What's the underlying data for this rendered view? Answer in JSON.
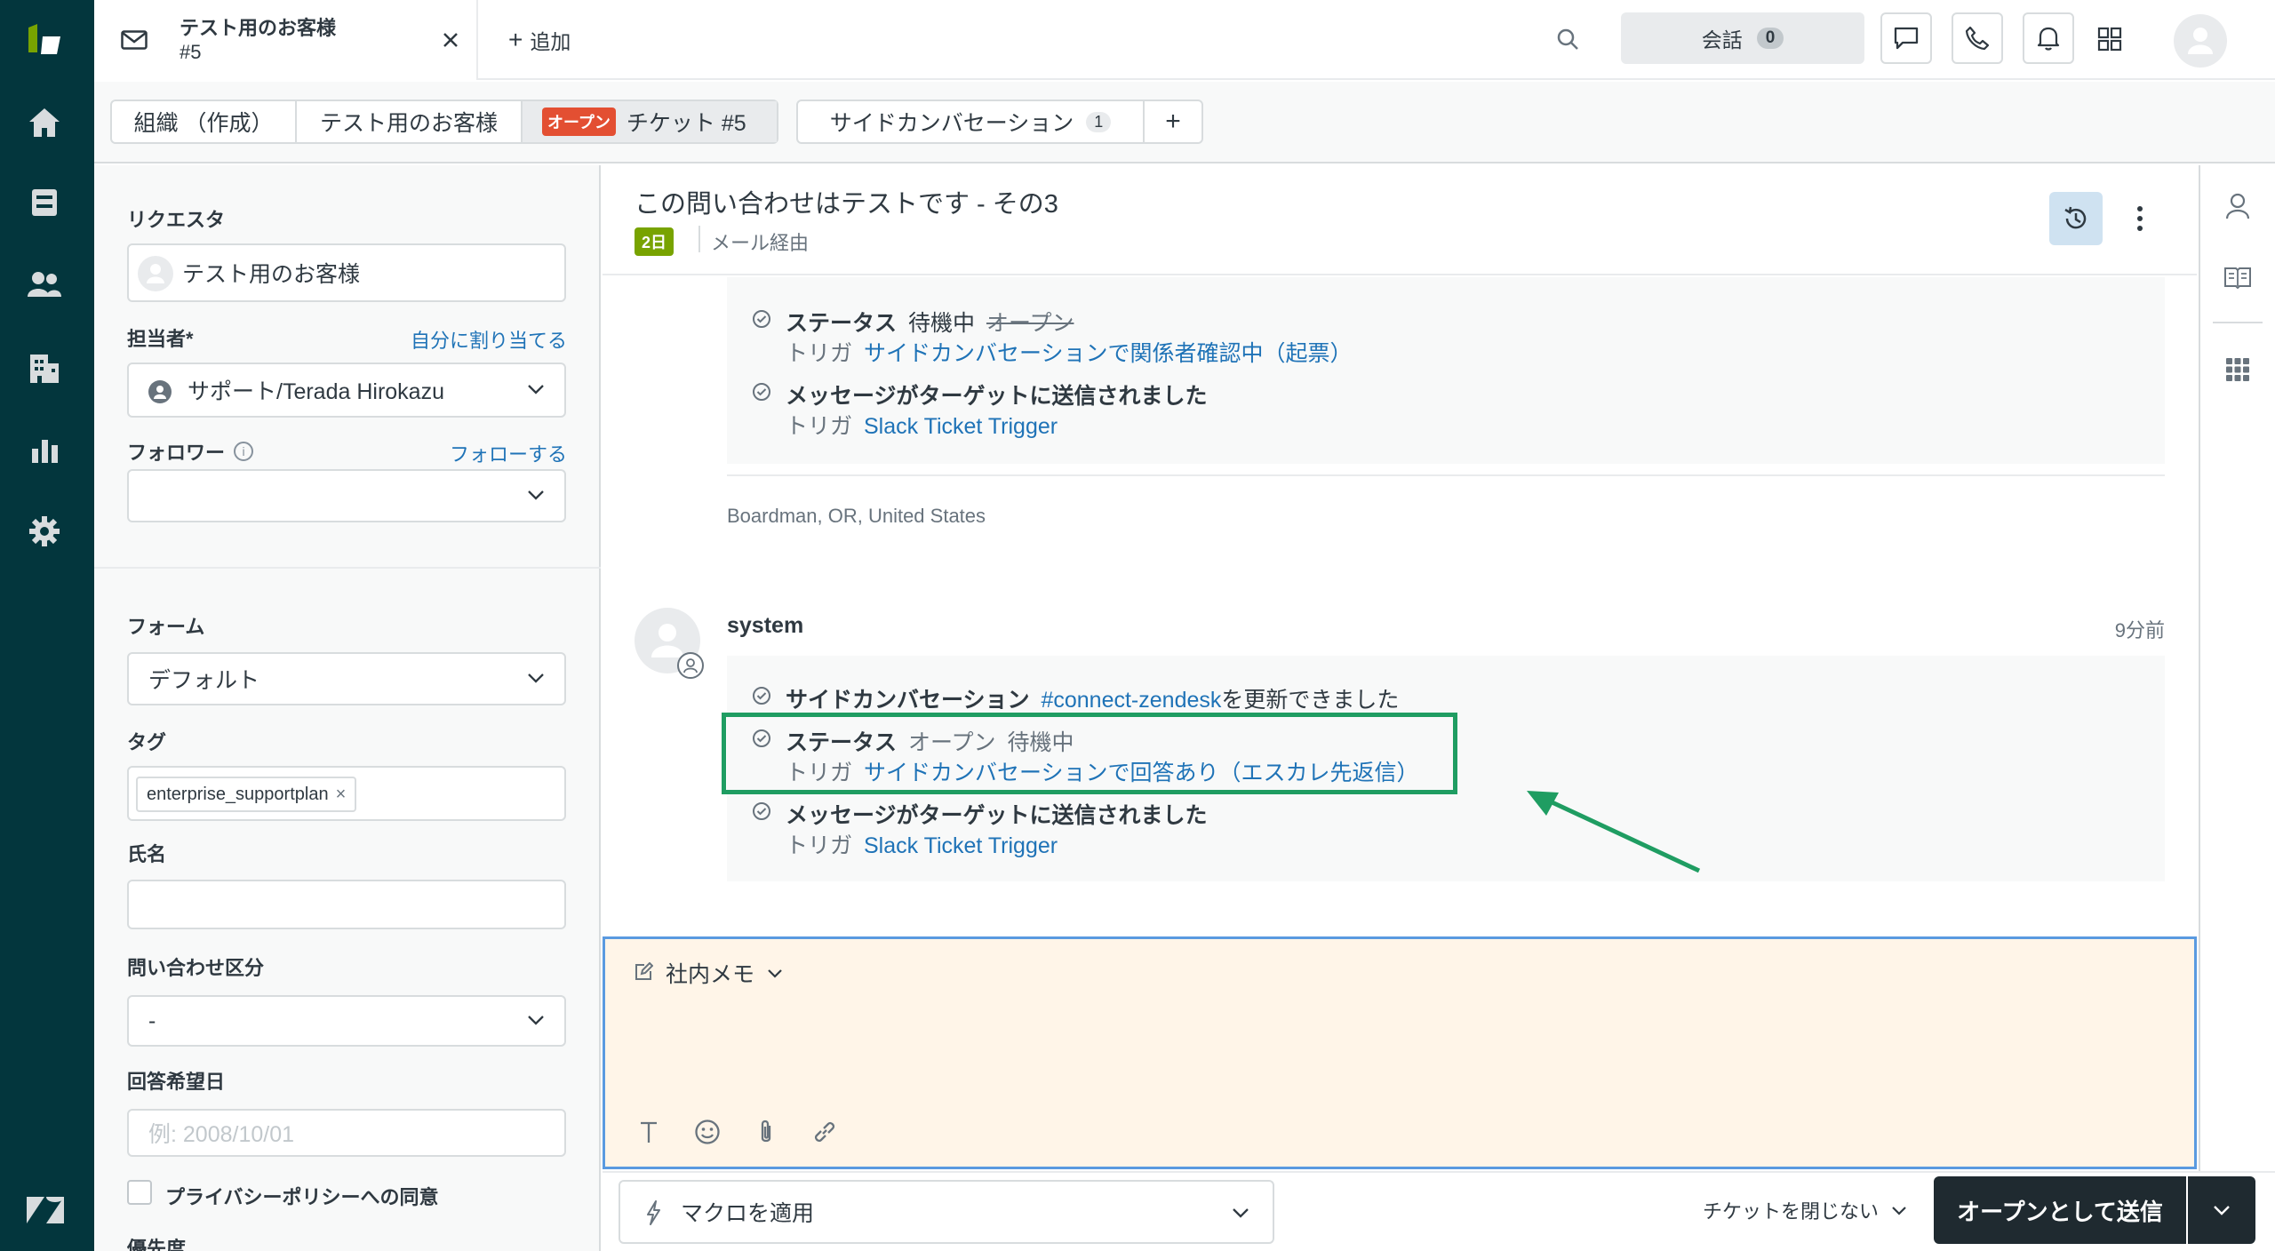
{
  "top_tab": {
    "title": "テスト用のお客様",
    "subtitle": "#5"
  },
  "add_tab_label": "追加",
  "header": {
    "conversations_label": "会話",
    "conversations_count": "0"
  },
  "context_tabs": {
    "org": "組織 （作成）",
    "customer": "テスト用のお客様",
    "ticket_badge": "オープン",
    "ticket": "チケット #5",
    "side_conv": "サイドカンバセーション",
    "side_conv_count": "1",
    "plus": "+"
  },
  "sidebar": {
    "requester_label": "リクエスタ",
    "requester_value": "テスト用のお客様",
    "assignee_label": "担当者*",
    "assign_self": "自分に割り当てる",
    "assignee_value": "サポート/Terada Hirokazu",
    "followers_label": "フォロワー",
    "follow_link": "フォローする",
    "form_label": "フォーム",
    "form_value": "デフォルト",
    "tags_label": "タグ",
    "tag": "enterprise_supportplan",
    "name_label": "氏名",
    "inquiry_label": "問い合わせ区分",
    "inquiry_value": "-",
    "due_label": "回答希望日",
    "due_placeholder": "例: 2008/10/01",
    "privacy_label": "プライバシーポリシーへの同意",
    "priority_label": "優先度"
  },
  "ticket": {
    "title": "この問い合わせはテストです - その3",
    "age_badge": "2日",
    "channel": "メール経由"
  },
  "events_top": {
    "status_label": "ステータス",
    "status_new": "待機中",
    "status_old": "オープン",
    "trigger_prefix": "トリガ",
    "trigger1": "サイドカンバセーションで関係者確認中（起票）",
    "msg_sent": "メッセージがターゲットに送信されました",
    "trigger2": "Slack Ticket Trigger",
    "location": "Boardman, OR, United States"
  },
  "system_event": {
    "author": "system",
    "time": "9分前",
    "side_conv_label": "サイドカンバセーション",
    "channel": "#connect-zendesk",
    "updated": "を更新できました",
    "status_label": "ステータス",
    "status_old": "オープン",
    "status_new": "待機中",
    "trigger_prefix": "トリガ",
    "trigger1": "サイドカンバセーションで回答あり（エスカレ先返信）",
    "msg_sent": "メッセージがターゲットに送信されました",
    "trigger2": "Slack Ticket Trigger"
  },
  "composer": {
    "mode": "社内メモ"
  },
  "footer": {
    "macro": "マクロを適用",
    "close_option": "チケットを閉じない",
    "submit": "オープンとして送信"
  },
  "colors": {
    "nav_bg": "#03363d",
    "accent_green": "#1f9d62",
    "link": "#1f73b7",
    "open_badge": "#e34f32",
    "submit_bg": "#1f2a30"
  }
}
